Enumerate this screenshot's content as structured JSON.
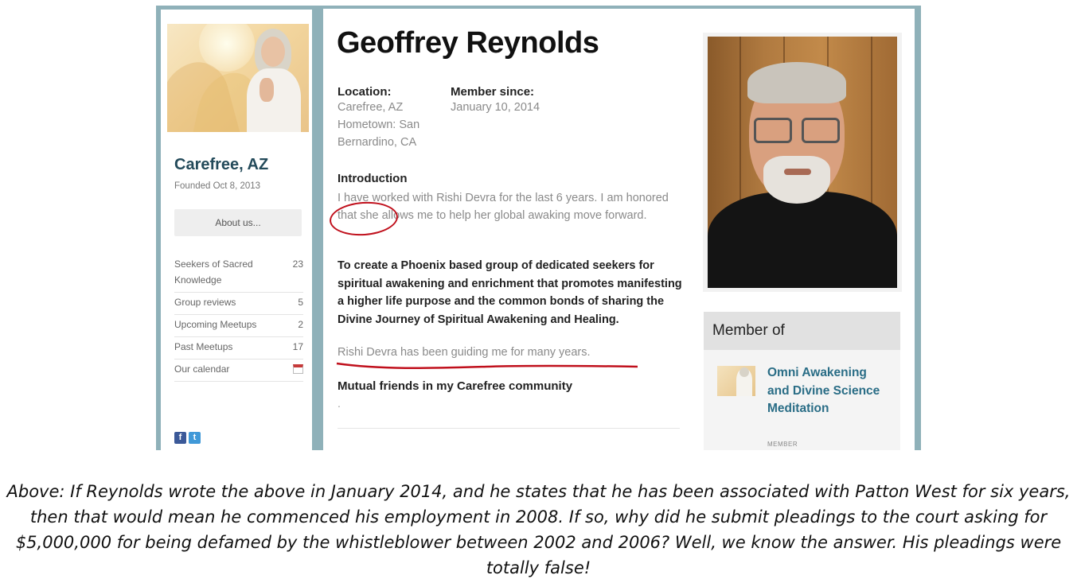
{
  "sidebar": {
    "city": "Carefree, AZ",
    "founded": "Founded Oct 8, 2013",
    "about_label": "About us...",
    "stats": [
      {
        "label": "Seekers of Sacred Knowledge",
        "count": "23"
      },
      {
        "label": "Group reviews",
        "count": "5"
      },
      {
        "label": "Upcoming Meetups",
        "count": "2"
      },
      {
        "label": "Past Meetups",
        "count": "17"
      },
      {
        "label": "Our calendar",
        "count": ""
      }
    ],
    "social": [
      "f",
      "t"
    ]
  },
  "profile": {
    "name": "Geoffrey Reynolds",
    "location_label": "Location:",
    "location_value": "Carefree, AZ",
    "hometown": "Hometown: San Bernardino, CA",
    "member_since_label": "Member since:",
    "member_since_value": "January 10, 2014",
    "intro_label": "Introduction",
    "intro_text": "I have worked with Rishi Devra for the last 6 years. I am honored that she allows me to help her global awaking move forward.",
    "mission": "To create a Phoenix based group of dedicated seekers for spiritual awakening and enrichment that promotes manifesting a higher life purpose and the common bonds of sharing the Divine Journey of Spiritual Awakening and Healing.",
    "guiding": "Rishi Devra has been guiding me for many years.",
    "mutual_label": "Mutual friends in my Carefree community",
    "mutual_value": "."
  },
  "member_of": {
    "heading": "Member of",
    "group_name": "Omni Awakening and Divine Science Meditation",
    "role": "MEMBER"
  },
  "caption": "Above: If Reynolds wrote the above in January 2014, and he states that he has been associated with Patton West for six years, then that would mean he commenced his employment in 2008.  If so, why did he submit pleadings to the court asking for $5,000,000 for being defamed by the whistleblower between 2002 and 2006?  Well, we know the answer. His pleadings were totally false!",
  "colors": {
    "frame": "#8fb1b9",
    "link": "#2a6d86",
    "annotation": "#c0101c"
  }
}
